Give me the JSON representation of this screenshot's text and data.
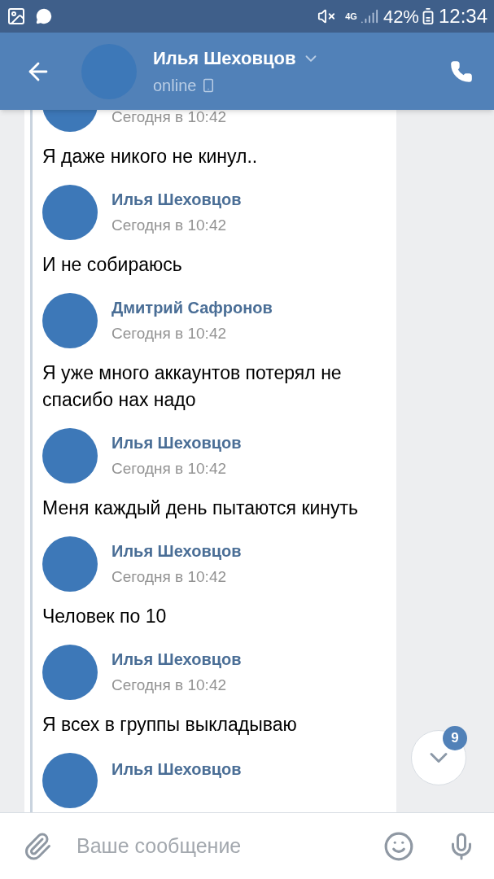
{
  "status_bar": {
    "network": "4G",
    "battery": "42%",
    "time": "12:34"
  },
  "header": {
    "name": "Илья Шеховцов",
    "status": "online"
  },
  "messages": [
    {
      "time": "Сегодня в 10:42",
      "text": "Я даже никого не кинул.."
    },
    {
      "author": "Илья Шеховцов",
      "time": "Сегодня в 10:42",
      "text": "И не собираюсь"
    },
    {
      "author": "Дмитрий Сафронов",
      "time": "Сегодня в 10:42",
      "text": "Я уже много аккаунтов потерял не спасибо нах надо"
    },
    {
      "author": "Илья Шеховцов",
      "time": "Сегодня в 10:42",
      "text": "Меня каждый день пытаются кинуть"
    },
    {
      "author": "Илья Шеховцов",
      "time": "Сегодня в 10:42",
      "text": "Человек по 10"
    },
    {
      "author": "Илья Шеховцов",
      "time": "Сегодня в 10:42",
      "text": "Я всех в группы выкладываю"
    },
    {
      "author": "Илья Шеховцов"
    }
  ],
  "scroll_button": {
    "badge": "9"
  },
  "composer": {
    "placeholder": "Ваше сообщение"
  }
}
